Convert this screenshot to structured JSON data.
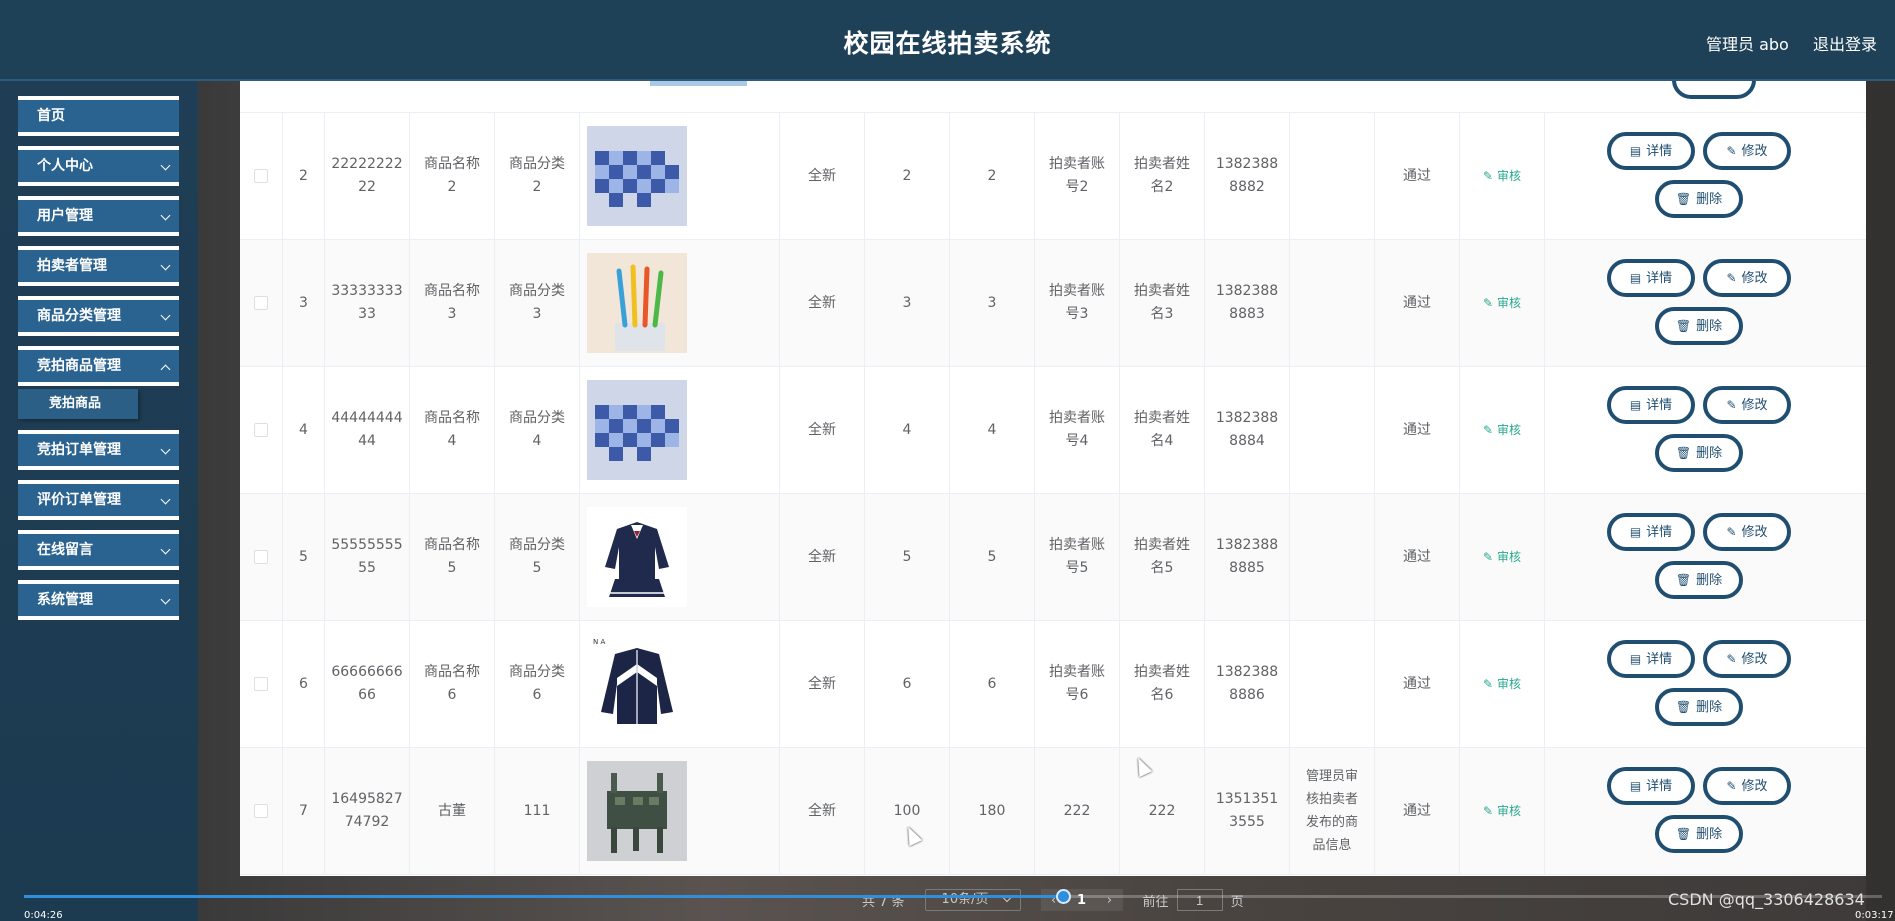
{
  "header": {
    "title": "校园在线拍卖系统",
    "user": "管理员 abo",
    "logout": "退出登录"
  },
  "sidebar": {
    "items": [
      {
        "label": "首页"
      },
      {
        "label": "个人中心"
      },
      {
        "label": "用户管理"
      },
      {
        "label": "拍卖者管理"
      },
      {
        "label": "商品分类管理"
      },
      {
        "label": "竞拍商品管理"
      },
      {
        "label": "竞拍订单管理"
      },
      {
        "label": "评价订单管理"
      },
      {
        "label": "在线留言"
      },
      {
        "label": "系统管理"
      }
    ],
    "active_sub": "竞拍商品"
  },
  "table": {
    "buttons": {
      "detail": "详情",
      "edit": "修改",
      "delete": "删除",
      "audit": "审核"
    },
    "rows": [
      {
        "index": "2",
        "code": "22222222\n22",
        "name": "商品名称\n2",
        "category": "商品分类\n2",
        "condition": "全新",
        "start_price": "2",
        "current_price": "2",
        "seller_account": "拍卖者账\n号2",
        "seller_name": "拍卖者姓\n名2",
        "phone": "1382388\n8882",
        "reply": "",
        "status": "通过",
        "img": "bedding"
      },
      {
        "index": "3",
        "code": "33333333\n33",
        "name": "商品名称\n3",
        "category": "商品分类\n3",
        "condition": "全新",
        "start_price": "3",
        "current_price": "3",
        "seller_account": "拍卖者账\n号3",
        "seller_name": "拍卖者姓\n名3",
        "phone": "1382388\n8883",
        "reply": "",
        "status": "通过",
        "img": "toothbrush"
      },
      {
        "index": "4",
        "code": "44444444\n44",
        "name": "商品名称\n4",
        "category": "商品分类\n4",
        "condition": "全新",
        "start_price": "4",
        "current_price": "4",
        "seller_account": "拍卖者账\n号4",
        "seller_name": "拍卖者姓\n名4",
        "phone": "1382388\n8884",
        "reply": "",
        "status": "通过",
        "img": "bedding"
      },
      {
        "index": "5",
        "code": "55555555\n55",
        "name": "商品名称\n5",
        "category": "商品分类\n5",
        "condition": "全新",
        "start_price": "5",
        "current_price": "5",
        "seller_account": "拍卖者账\n号5",
        "seller_name": "拍卖者姓\n名5",
        "phone": "1382388\n8885",
        "reply": "",
        "status": "通过",
        "img": "uniform"
      },
      {
        "index": "6",
        "code": "66666666\n66",
        "name": "商品名称\n6",
        "category": "商品分类\n6",
        "condition": "全新",
        "start_price": "6",
        "current_price": "6",
        "seller_account": "拍卖者账\n号6",
        "seller_name": "拍卖者姓\n名6",
        "phone": "1382388\n8886",
        "reply": "",
        "status": "通过",
        "img": "jacket"
      },
      {
        "index": "7",
        "code": "16495827\n74792",
        "name": "古董",
        "category": "111",
        "condition": "全新",
        "start_price": "100",
        "current_price": "180",
        "seller_account": "222",
        "seller_name": "222",
        "phone": "1351351\n3555",
        "reply": "管理员审\n核拍卖者\n发布的商\n品信息",
        "status": "通过",
        "img": "bronze"
      }
    ]
  },
  "pager": {
    "total": "共 7 条",
    "page_size": "10条/页",
    "current_page": "1",
    "goto_label": "前往",
    "goto_value": "1",
    "page_suffix": "页"
  },
  "video": {
    "elapsed": "0:04:26",
    "duration": "0:03:17",
    "progress": 0.585,
    "watermark": "CSDN @qq_3306428634"
  },
  "colors": {
    "header_bg": "#1f4158",
    "menu_bg": "#2a6290",
    "button_border": "#1f4e70",
    "audit": "#2aa88f",
    "progress": "#2f8fdd"
  }
}
